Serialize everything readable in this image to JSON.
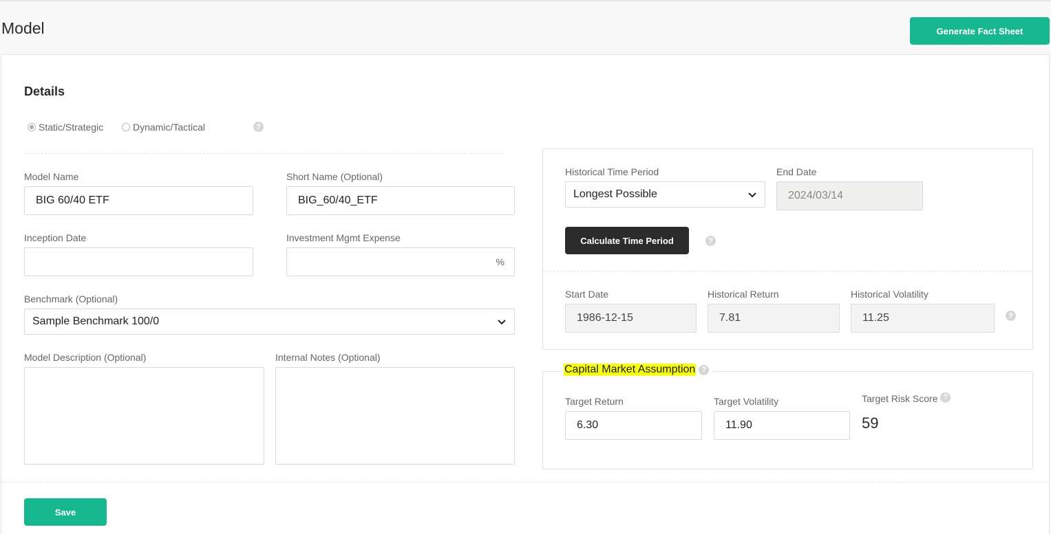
{
  "header": {
    "title": "Model",
    "generate_label": "Generate Fact Sheet"
  },
  "details": {
    "title": "Details",
    "strategy_options": [
      {
        "label": "Static/Strategic",
        "selected": true
      },
      {
        "label": "Dynamic/Tactical",
        "selected": false
      }
    ],
    "help_glyph": "?",
    "model_name": {
      "label": "Model Name",
      "value": "BIG 60/40 ETF"
    },
    "short_name": {
      "label": "Short Name (Optional)",
      "value": "BIG_60/40_ETF"
    },
    "inception_date": {
      "label": "Inception Date",
      "value": ""
    },
    "mgmt_expense": {
      "label": "Investment Mgmt Expense",
      "value": "",
      "suffix": "%"
    },
    "benchmark": {
      "label": "Benchmark (Optional)",
      "value": "Sample Benchmark 100/0"
    },
    "description": {
      "label": "Model Description (Optional)",
      "value": ""
    },
    "notes": {
      "label": "Internal Notes (Optional)",
      "value": ""
    }
  },
  "historical": {
    "time_period": {
      "label": "Historical Time Period",
      "value": "Longest Possible"
    },
    "end_date": {
      "label": "End Date",
      "value": "2024/03/14"
    },
    "calc_label": "Calculate Time Period",
    "start_date": {
      "label": "Start Date",
      "value": "1986-12-15"
    },
    "return": {
      "label": "Historical Return",
      "value": "7.81"
    },
    "volatility": {
      "label": "Historical Volatility",
      "value": "11.25"
    }
  },
  "cma": {
    "title": "Capital Market Assumption",
    "target_return": {
      "label": "Target Return",
      "value": "6.30"
    },
    "target_volatility": {
      "label": "Target Volatility",
      "value": "11.90"
    },
    "target_risk": {
      "label": "Target Risk Score",
      "value": "59"
    }
  },
  "footer": {
    "save_label": "Save"
  },
  "colors": {
    "accent": "#17b890",
    "dark_button": "#2b2b2b",
    "highlight": "#f7ff14"
  },
  "icons": {
    "help": "question-circle-icon",
    "dropdown": "chevron-down-icon"
  }
}
